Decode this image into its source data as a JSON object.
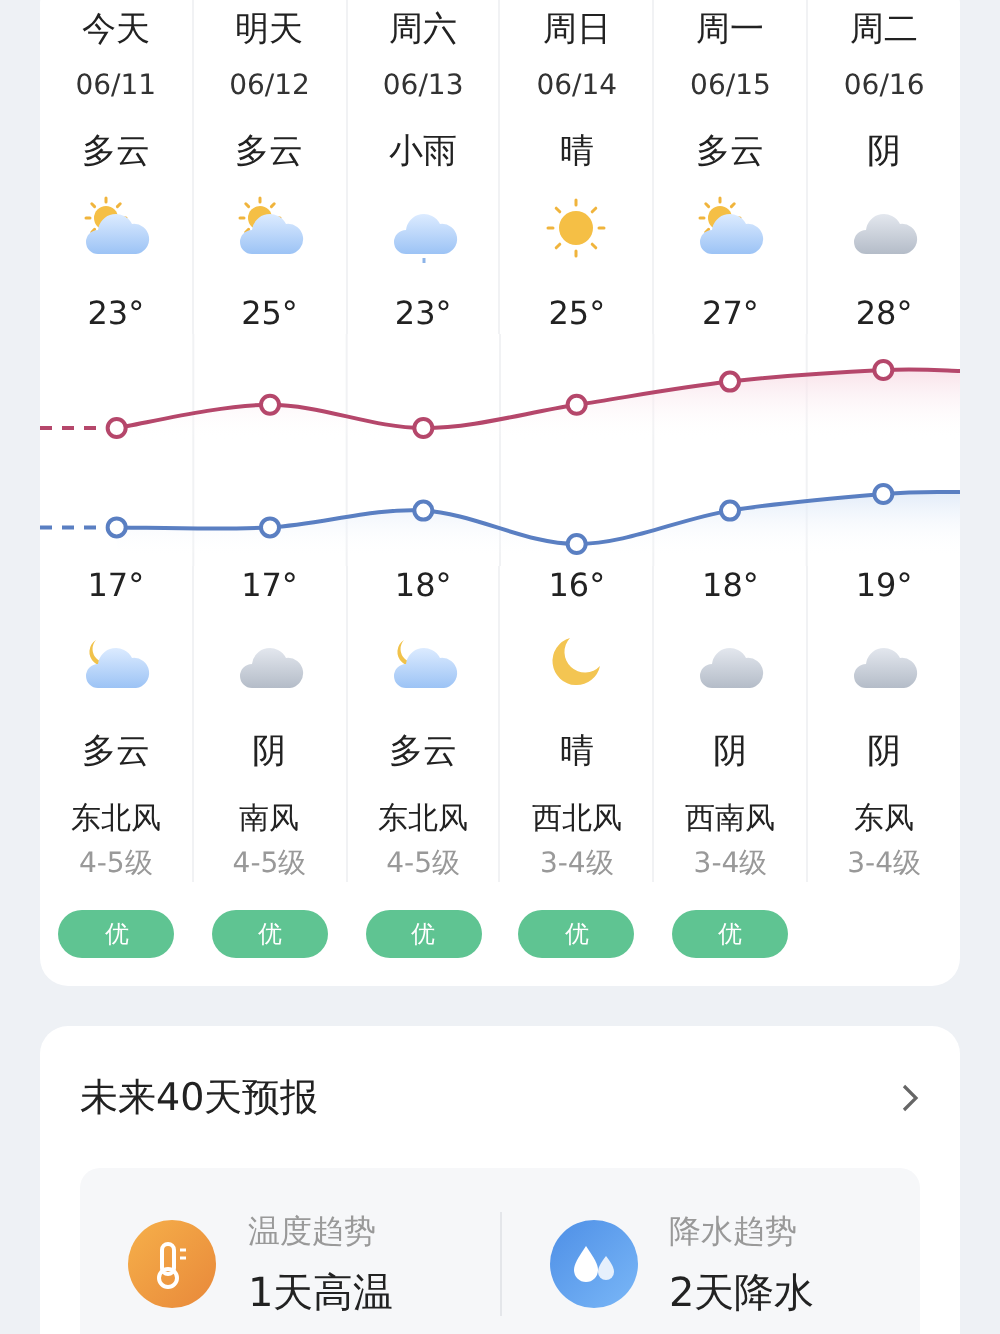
{
  "forecast": {
    "days": [
      {
        "name": "今天",
        "date": "06/11",
        "day": {
          "kind": "sun-cloud",
          "weather": "多云",
          "temp": "23°"
        },
        "night": {
          "kind": "moon-cloud",
          "temp": "17°",
          "weather": "多云"
        },
        "wind_dir": "东北风",
        "wind_level": "4-5级",
        "aqi": {
          "text": "优",
          "color": "#5fc492"
        }
      },
      {
        "name": "明天",
        "date": "06/12",
        "day": {
          "kind": "sun-cloud",
          "weather": "多云",
          "temp": "25°"
        },
        "night": {
          "kind": "cloud",
          "temp": "17°",
          "weather": "阴"
        },
        "wind_dir": "南风",
        "wind_level": "4-5级",
        "aqi": {
          "text": "优",
          "color": "#5fc492"
        }
      },
      {
        "name": "周六",
        "date": "06/13",
        "day": {
          "kind": "rain-cloud",
          "weather": "小雨",
          "temp": "23°"
        },
        "night": {
          "kind": "moon-cloud",
          "temp": "18°",
          "weather": "多云"
        },
        "wind_dir": "东北风",
        "wind_level": "4-5级",
        "aqi": {
          "text": "优",
          "color": "#5fc492"
        }
      },
      {
        "name": "周日",
        "date": "06/14",
        "day": {
          "kind": "sun",
          "weather": "晴",
          "temp": "25°"
        },
        "night": {
          "kind": "moon",
          "temp": "16°",
          "weather": "晴"
        },
        "wind_dir": "西北风",
        "wind_level": "3-4级",
        "aqi": {
          "text": "优",
          "color": "#5fc492"
        }
      },
      {
        "name": "周一",
        "date": "06/15",
        "day": {
          "kind": "sun-cloud",
          "weather": "多云",
          "temp": "27°"
        },
        "night": {
          "kind": "cloud",
          "temp": "18°",
          "weather": "阴"
        },
        "wind_dir": "西南风",
        "wind_level": "3-4级",
        "aqi": {
          "text": "优",
          "color": "#5fc492"
        }
      },
      {
        "name": "周二",
        "date": "06/16",
        "day": {
          "kind": "cloud",
          "weather": "阴",
          "temp": "28°"
        },
        "night": {
          "kind": "cloud",
          "temp": "19°",
          "weather": "阴"
        },
        "wind_dir": "东风",
        "wind_level": "3-4级"
      }
    ]
  },
  "outlook": {
    "title": "未来40天预报",
    "trends": [
      {
        "kind": "temperature",
        "label": "温度趋势",
        "value": "1天高温"
      },
      {
        "kind": "precipitation",
        "label": "降水趋势",
        "value": "2天降水"
      }
    ]
  }
}
